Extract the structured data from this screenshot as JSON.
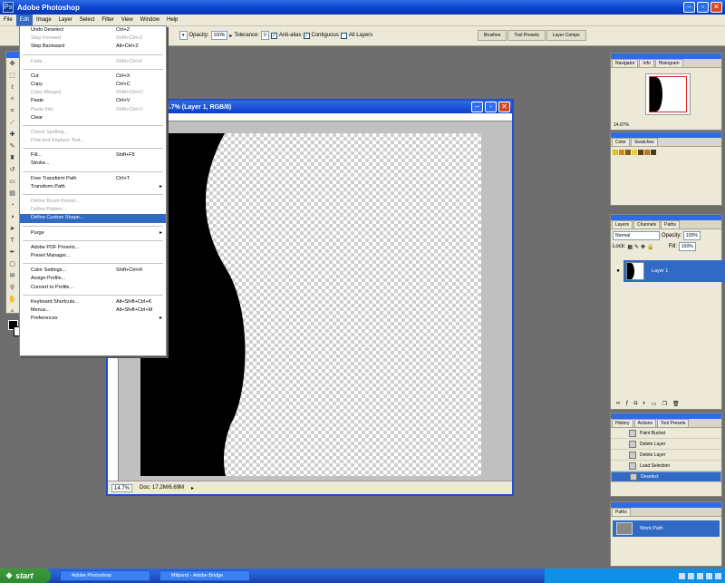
{
  "window": {
    "title": "Adobe Photoshop"
  },
  "menubar": [
    "File",
    "Edit",
    "Image",
    "Layer",
    "Select",
    "Filter",
    "View",
    "Window",
    "Help"
  ],
  "options": {
    "mode": "",
    "opacity_label": "Opacity:",
    "opacity_value": "100%",
    "tolerance_label": "Tolerance:",
    "tolerance_value": "0",
    "antialias_label": "Anti-alias",
    "contiguous_label": "Contiguous",
    "all_layers_label": "All Layers",
    "dock_tabs": [
      "Brushes",
      "Tool Presets",
      "Layer Comps"
    ]
  },
  "edit_menu": [
    {
      "label": "Undo Deselect",
      "shortcut": "Ctrl+Z",
      "state": "normal"
    },
    {
      "label": "Step Forward",
      "shortcut": "Shift+Ctrl+Z",
      "state": "disabled"
    },
    {
      "label": "Step Backward",
      "shortcut": "Alt+Ctrl+Z",
      "state": "normal"
    },
    {
      "sep": true
    },
    {
      "label": "Fade...",
      "shortcut": "Shift+Ctrl+F",
      "state": "disabled"
    },
    {
      "sep": true
    },
    {
      "label": "Cut",
      "shortcut": "Ctrl+X",
      "state": "normal"
    },
    {
      "label": "Copy",
      "shortcut": "Ctrl+C",
      "state": "normal"
    },
    {
      "label": "Copy Merged",
      "shortcut": "Shift+Ctrl+C",
      "state": "disabled"
    },
    {
      "label": "Paste",
      "shortcut": "Ctrl+V",
      "state": "normal"
    },
    {
      "label": "Paste Into",
      "shortcut": "Shift+Ctrl+V",
      "state": "disabled"
    },
    {
      "label": "Clear",
      "shortcut": "",
      "state": "normal"
    },
    {
      "sep": true
    },
    {
      "label": "Check Spelling...",
      "shortcut": "",
      "state": "disabled"
    },
    {
      "label": "Find and Replace Text...",
      "shortcut": "",
      "state": "disabled"
    },
    {
      "sep": true
    },
    {
      "label": "Fill...",
      "shortcut": "Shift+F5",
      "state": "normal"
    },
    {
      "label": "Stroke...",
      "shortcut": "",
      "state": "normal"
    },
    {
      "sep": true
    },
    {
      "label": "Free Transform Path",
      "shortcut": "Ctrl+T",
      "state": "normal"
    },
    {
      "label": "Transform Path",
      "shortcut": "",
      "state": "normal",
      "submenu": true
    },
    {
      "sep": true
    },
    {
      "label": "Define Brush Preset...",
      "shortcut": "",
      "state": "disabled"
    },
    {
      "label": "Define Pattern...",
      "shortcut": "",
      "state": "disabled"
    },
    {
      "label": "Define Custom Shape...",
      "shortcut": "",
      "state": "highlight"
    },
    {
      "sep": true
    },
    {
      "label": "Purge",
      "shortcut": "",
      "state": "normal",
      "submenu": true
    },
    {
      "sep": true
    },
    {
      "label": "Adobe PDF Presets...",
      "shortcut": "",
      "state": "normal"
    },
    {
      "label": "Preset Manager...",
      "shortcut": "",
      "state": "normal"
    },
    {
      "sep": true
    },
    {
      "label": "Color Settings...",
      "shortcut": "Shift+Ctrl+K",
      "state": "normal"
    },
    {
      "label": "Assign Profile...",
      "shortcut": "",
      "state": "normal"
    },
    {
      "label": "Convert to Profile...",
      "shortcut": "",
      "state": "normal"
    },
    {
      "sep": true
    },
    {
      "label": "Keyboard Shortcuts...",
      "shortcut": "Alt+Shift+Ctrl+K",
      "state": "normal"
    },
    {
      "label": "Menus...",
      "shortcut": "Alt+Shift+Ctrl+M",
      "state": "normal"
    },
    {
      "label": "Preferences",
      "shortcut": "",
      "state": "normal",
      "submenu": true
    }
  ],
  "document": {
    "title": "14.7% (Layer 1, RGB/8)",
    "zoom": "14.7%",
    "doc_info": "Doc: 17.2M/6.69M"
  },
  "navigator": {
    "tabs": [
      "Navigator",
      "Info",
      "Histogram"
    ],
    "zoom": "14.67%"
  },
  "swatches": {
    "tabs": [
      "Color",
      "Swatches"
    ]
  },
  "layers": {
    "tabs": [
      "Layers",
      "Channels",
      "Paths"
    ],
    "blend_mode": "Normal",
    "opacity_label": "Opacity:",
    "opacity_value": "100%",
    "lock_label": "Lock:",
    "fill_label": "Fill:",
    "fill_value": "100%",
    "layer_name": "Layer 1"
  },
  "history": {
    "tabs": [
      "History",
      "Actions",
      "Tool Presets"
    ],
    "items": [
      "Paint Bucket",
      "Delete Layer",
      "Delete Layer",
      "Load Selection",
      "Deselect"
    ],
    "selected_index": 4
  },
  "paths": {
    "tabs": [
      "Paths"
    ],
    "path_name": "Work Path"
  },
  "taskbar": {
    "start": "start",
    "tasks": [
      "Adobe Photoshop",
      "Milpond - Adobe Bridge"
    ]
  },
  "colors": {
    "highlight": "#316ac5",
    "xp_title": "#0a3fc9",
    "canvas_bg": "#6e6e6e"
  }
}
